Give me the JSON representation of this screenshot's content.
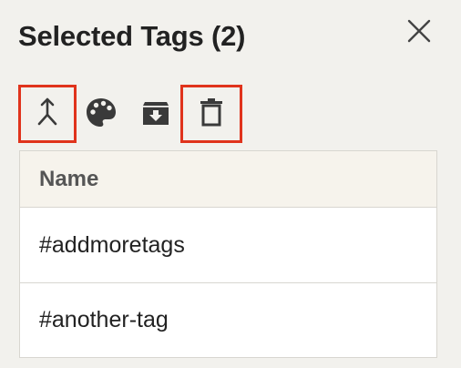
{
  "panel": {
    "title": "Selected Tags (2)",
    "close_icon": "close-icon"
  },
  "toolbar": {
    "buttons": [
      {
        "icon": "merge-icon",
        "highlighted": true
      },
      {
        "icon": "palette-icon",
        "highlighted": false
      },
      {
        "icon": "archive-icon",
        "highlighted": false
      },
      {
        "icon": "trash-icon",
        "highlighted": true
      }
    ],
    "highlight_color": "#e0331c"
  },
  "table": {
    "columns": [
      "Name"
    ],
    "rows": [
      {
        "name": "#addmoretags"
      },
      {
        "name": "#another-tag"
      }
    ]
  }
}
